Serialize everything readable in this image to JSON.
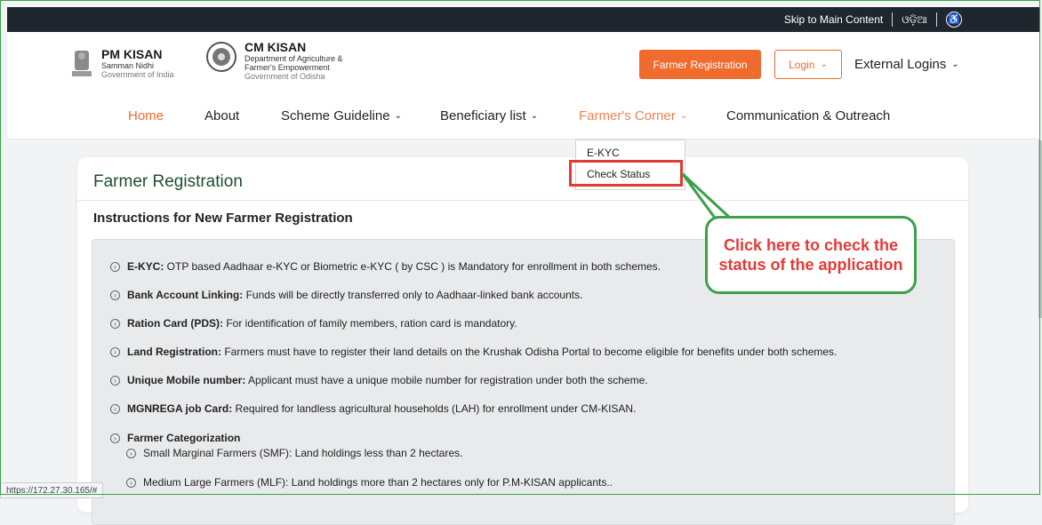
{
  "topbar": {
    "skip_link": "Skip to Main Content",
    "language": "ଓଡ଼ିଆ",
    "accessibility_icon": "accessibility-icon"
  },
  "header": {
    "pm_logo": {
      "title": "PM KISAN",
      "line1": "Samman Nidhi",
      "line2": "Government of India"
    },
    "cm_logo": {
      "title": "CM KISAN",
      "line1": "Department of Agriculture &",
      "line2": "Farmer's Empowerment",
      "line3": "Government of Odisha"
    },
    "register_button": "Farmer Registration",
    "login_button": "Login",
    "external_logins": "External Logins"
  },
  "nav": {
    "items": [
      "Home",
      "About",
      "Scheme Guideline",
      "Beneficiary list",
      "Farmer's Corner",
      "Communication & Outreach"
    ]
  },
  "dropdown": {
    "items": [
      "E-KYC",
      "Check Status"
    ]
  },
  "callout": {
    "text": "Click here to check the status of the application"
  },
  "card": {
    "title": "Farmer Registration",
    "subtitle": "Instructions for New Farmer Registration",
    "items": [
      {
        "label": "E-KYC:",
        "text": " OTP based Aadhaar e-KYC or Biometric e-KYC ( by CSC ) is Mandatory for enrollment in both schemes."
      },
      {
        "label": "Bank Account Linking:",
        "text": " Funds will be directly transferred only to Aadhaar-linked bank accounts."
      },
      {
        "label": "Ration Card (PDS):",
        "text": " For identification of family members, ration card is mandatory."
      },
      {
        "label": "Land Registration:",
        "text": " Farmers must have to register their land details on the Krushak Odisha Portal to become eligible for benefits under both schemes."
      },
      {
        "label": "Unique Mobile number:",
        "text": " Applicant must have a unique mobile number for registration under both the scheme."
      },
      {
        "label": "MGNREGA job Card:",
        "text": " Required for landless agricultural households (LAH) for enrollment under CM-KISAN."
      },
      {
        "label": "Farmer Categorization",
        "text": ""
      }
    ],
    "subitems": [
      "Small Marginal Farmers (SMF): Land holdings less than 2 hectares.",
      "Medium Large Farmers (MLF): Land holdings more than 2 hectares only for P.M-KISAN applicants.."
    ]
  },
  "statusbar": {
    "url": "https://172.27.30.165/#"
  },
  "colors": {
    "accent": "#ef6b2e",
    "callout_border": "#3aa14a",
    "highlight": "#e53935"
  }
}
